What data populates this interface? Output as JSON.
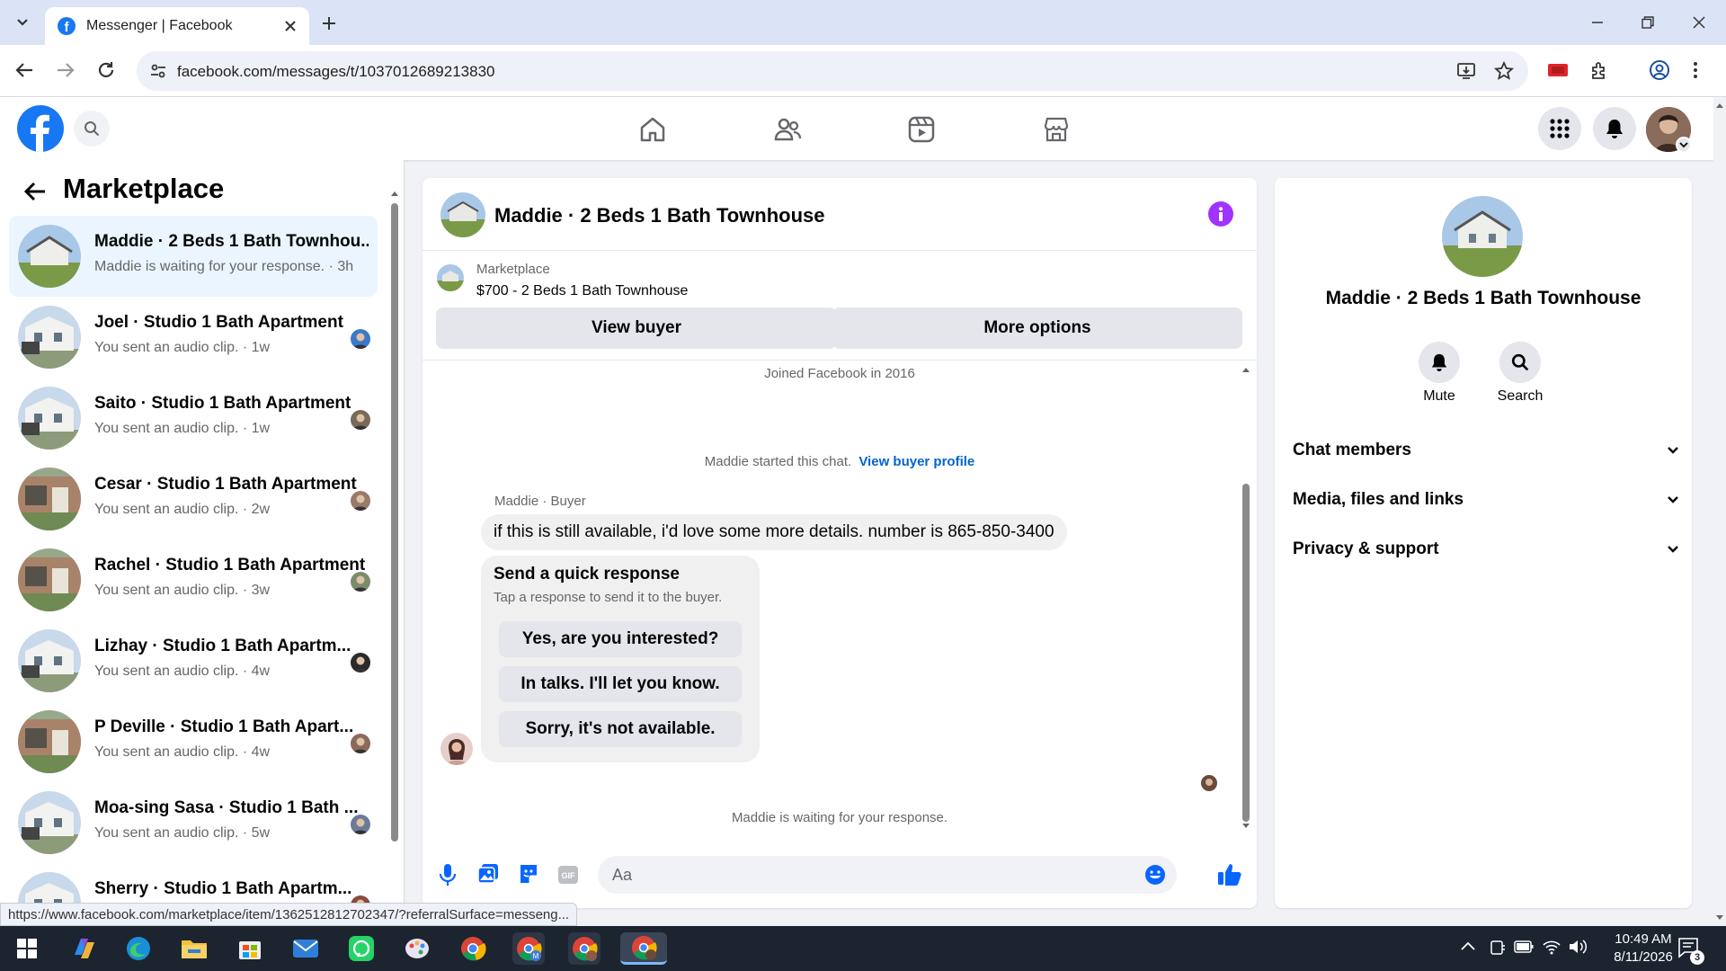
{
  "browser": {
    "tab_title": "Messenger | Facebook",
    "url": "facebook.com/messages/t/1037012689213830",
    "status_url": "https://www.facebook.com/marketplace/item/1362512812702347/?referralSurface=messeng..."
  },
  "sidebar": {
    "title": "Marketplace",
    "conversations": [
      {
        "name": "Maddie · 2 Beds 1 Bath Townhou...",
        "preview": "Maddie is waiting for your response. · 3h",
        "active": true
      },
      {
        "name": "Joel · Studio 1 Bath Apartment",
        "preview": "You sent an audio clip. · 1w"
      },
      {
        "name": "Saito · Studio 1 Bath Apartment",
        "preview": "You sent an audio clip. · 1w"
      },
      {
        "name": "Cesar · Studio 1 Bath Apartment",
        "preview": "You sent an audio clip. · 2w"
      },
      {
        "name": "Rachel · Studio 1 Bath Apartment",
        "preview": "You sent an audio clip. · 3w"
      },
      {
        "name": "Lizhay · Studio 1 Bath Apartm...",
        "preview": "You sent an audio clip. · 4w"
      },
      {
        "name": "P Deville · Studio 1 Bath Apart...",
        "preview": "You sent an audio clip. · 4w"
      },
      {
        "name": "Moa-sing Sasa · Studio 1 Bath ...",
        "preview": "You sent an audio clip. · 5w"
      },
      {
        "name": "Sherry · Studio 1 Bath Apartm...",
        "preview": ""
      }
    ]
  },
  "chat": {
    "title": "Maddie · 2 Beds 1 Bath Townhouse",
    "listing_label": "Marketplace",
    "listing_price": "$700 - 2 Beds 1 Bath Townhouse",
    "view_buyer": "View buyer",
    "more_options": "More options",
    "joined": "Joined Facebook in 2016",
    "started_text": "Maddie started this chat.",
    "view_buyer_profile": "View buyer profile",
    "sender_label": "Maddie · Buyer",
    "message": "if this is still available, i'd love some more details. number is 865-850-3400",
    "quick_title": "Send a quick response",
    "quick_sub": "Tap a response to send it to the buyer.",
    "quick_responses": [
      "Yes, are you interested?",
      "In talks. I'll let you know.",
      "Sorry, it's not available."
    ],
    "waiting": "Maddie is waiting for your response.",
    "input_placeholder": "Aa"
  },
  "details": {
    "title": "Maddie · 2 Beds 1 Bath Townhouse",
    "mute": "Mute",
    "search": "Search",
    "sections": [
      "Chat members",
      "Media, files and links",
      "Privacy & support"
    ]
  },
  "taskbar": {
    "time": "10:49 AM",
    "date": "8/11/2026",
    "notif_count": "3"
  },
  "colors": {
    "brand": "#1877f2",
    "info": "#a033ff",
    "link": "#0064d1"
  }
}
